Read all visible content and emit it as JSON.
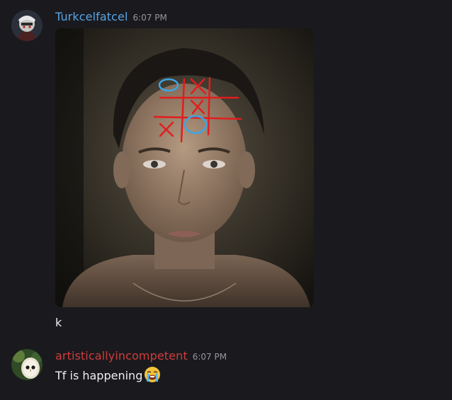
{
  "messages": [
    {
      "username": "Turkcelfatcel",
      "timestamp": "6:07 PM",
      "text": "k",
      "attachment": "image",
      "avatar": "user-avatar"
    },
    {
      "username": "artisticallyincompetent",
      "timestamp": "6:07 PM",
      "text": "Tf is happening",
      "emoji": "loudly-crying-face-emoji",
      "avatar": "owl-avatar"
    }
  ],
  "colors": {
    "background": "#1a1a1e",
    "username_1": "#57a5e8",
    "username_2": "#d03c3c",
    "timestamp": "#95979d",
    "text": "#eceef1"
  }
}
